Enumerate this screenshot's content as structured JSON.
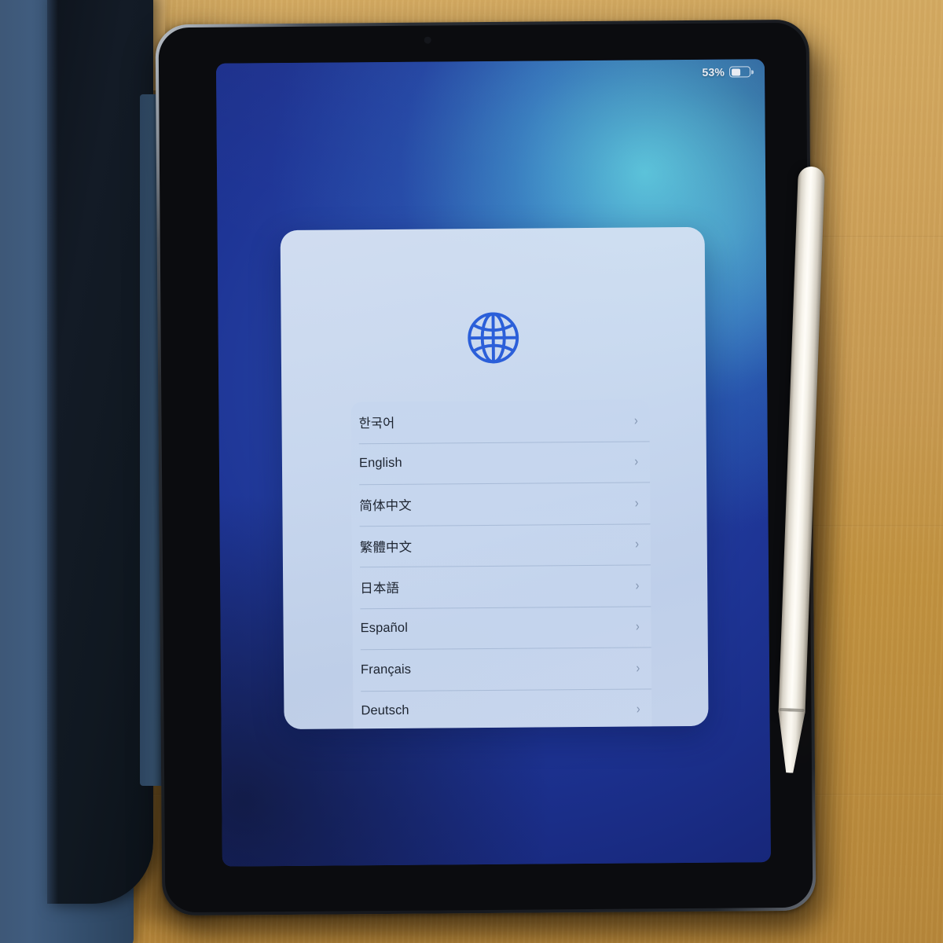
{
  "scene": {
    "device": "tablet",
    "surface": "wooden desk",
    "accessories": [
      "smart-folio-cover",
      "stylus-pencil"
    ]
  },
  "status_bar": {
    "battery_percent_label": "53%",
    "battery_level": 53,
    "battery_icon": "battery-half-icon"
  },
  "dialog": {
    "icon": "globe-icon",
    "icon_color": "#2b5fd9",
    "background_color": "#d2dff1",
    "list": {
      "items": [
        {
          "label": "한국어",
          "chevron": "›"
        },
        {
          "label": "English",
          "chevron": "›"
        },
        {
          "label": "简体中文",
          "chevron": "›"
        },
        {
          "label": "繁體中文",
          "chevron": "›"
        },
        {
          "label": "日本語",
          "chevron": "›"
        },
        {
          "label": "Español",
          "chevron": "›"
        },
        {
          "label": "Français",
          "chevron": "›"
        },
        {
          "label": "Deutsch",
          "chevron": "›"
        }
      ]
    }
  },
  "colors": {
    "wallpaper_deep_blue": "#1e3596",
    "wallpaper_glow_cyan": "#60d4e4",
    "desk_wood": "#c79a52",
    "folio_navy": "#3a5877",
    "pencil_white": "#f7f4ec",
    "text_primary": "#1d2430"
  }
}
